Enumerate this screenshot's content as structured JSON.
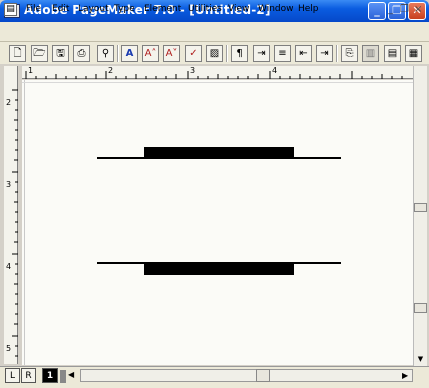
{
  "window": {
    "title": "Adobe PageMaker 7.0 - [Untitled-2]",
    "minimize_glyph": "_",
    "restore_glyph": "❐",
    "close_glyph": "✕"
  },
  "menu": {
    "items": [
      "File",
      "Edit",
      "Layout",
      "Type",
      "Element",
      "Utilities",
      "View",
      "Window",
      "Help"
    ],
    "mdi_minimize": "_",
    "mdi_restore": "❐",
    "mdi_close": "×"
  },
  "toolbar": {
    "buttons": [
      "new-icon",
      "open-icon",
      "save-icon",
      "print-icon",
      "find-icon",
      "text-tool-icon",
      "font-size-up-icon",
      "font-size-down-icon",
      "spelling-icon",
      "image-icon",
      "paragraph-icon",
      "align-icon",
      "bullets-icon",
      "indent-icon",
      "outdent-icon",
      "frame-icon",
      "layers-icon",
      "styles-icon",
      "colors-icon"
    ],
    "glyphs": [
      "🗋",
      "🗁",
      "🖫",
      "⎙",
      "⚲",
      "A",
      "A˄",
      "A˅",
      "✓",
      "▨",
      "¶",
      "⇥",
      "≡",
      "⇤",
      "⇥",
      "⎘",
      "▥",
      "▤",
      "▦"
    ]
  },
  "rulers": {
    "horizontal_labels": [
      "1",
      "2",
      "3",
      "4"
    ],
    "vertical_labels": [
      "2",
      "3",
      "4",
      "5"
    ]
  },
  "pages": {
    "left_master": "L",
    "right_master": "R",
    "current": "1"
  }
}
